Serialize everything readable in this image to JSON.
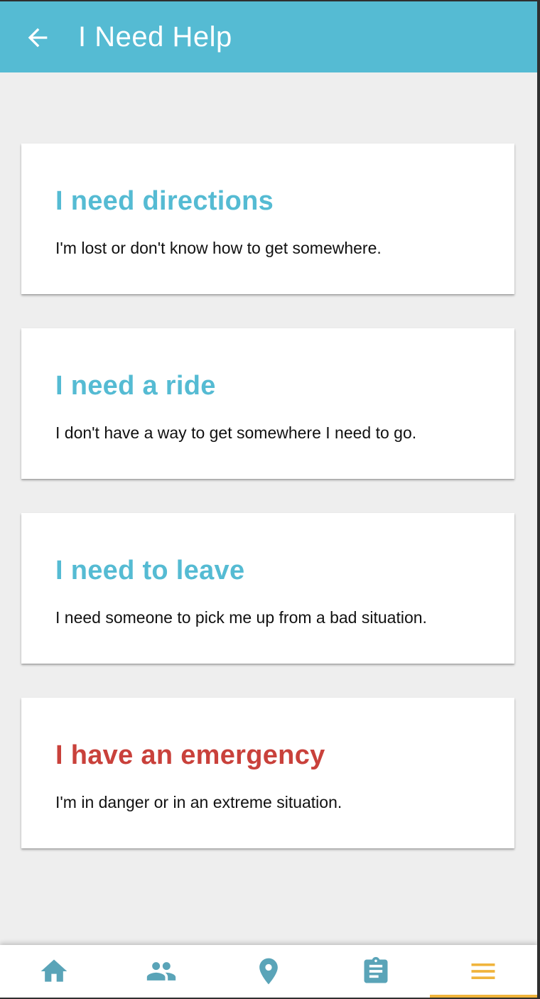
{
  "app_bar": {
    "title": "I Need Help",
    "back_icon": "arrow-back-icon",
    "background": "#55bbd3"
  },
  "cards": [
    {
      "title": "I need directions",
      "description": "I'm lost or don't know how to get somewhere.",
      "title_color": "#55bbd3"
    },
    {
      "title": "I need a ride",
      "description": "I don't have a way to get somewhere I need to go.",
      "title_color": "#55bbd3"
    },
    {
      "title": "I need to leave",
      "description": "I need someone to pick me up from a bad situation.",
      "title_color": "#55bbd3"
    },
    {
      "title": "I have an emergency",
      "description": "I'm in danger or in an extreme situation.",
      "title_color": "#c9413b"
    }
  ],
  "bottom_nav": {
    "items": [
      {
        "icon": "home-icon",
        "active": false
      },
      {
        "icon": "people-icon",
        "active": false
      },
      {
        "icon": "location-pin-icon",
        "active": false
      },
      {
        "icon": "clipboard-icon",
        "active": false
      },
      {
        "icon": "menu-icon",
        "active": true
      }
    ],
    "icon_color": "#5aa4b8",
    "active_color": "#f0b43c"
  }
}
